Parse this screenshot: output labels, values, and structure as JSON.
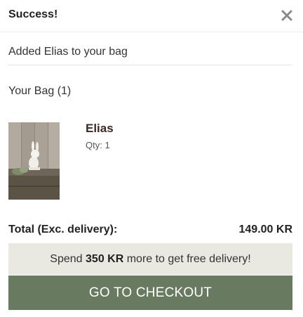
{
  "header": {
    "title": "Success!",
    "close_icon": "close-icon"
  },
  "message": {
    "added_text": "Added Elias to your bag"
  },
  "bag": {
    "heading": "Your Bag (1)",
    "items": [
      {
        "name": "Elias",
        "qty_text": "Qty: 1",
        "image_icon": "bunny-figurine-photo"
      }
    ]
  },
  "summary": {
    "total_label": "Total (Exc. delivery):",
    "total_value": "149.00 KR"
  },
  "promo": {
    "prefix": "Spend ",
    "amount": "350 KR",
    "suffix": " more to get free delivery!"
  },
  "actions": {
    "checkout_label": "GO TO CHECKOUT"
  },
  "colors": {
    "checkout_bg": "#687a60",
    "promo_bg": "#e9e9e1"
  }
}
